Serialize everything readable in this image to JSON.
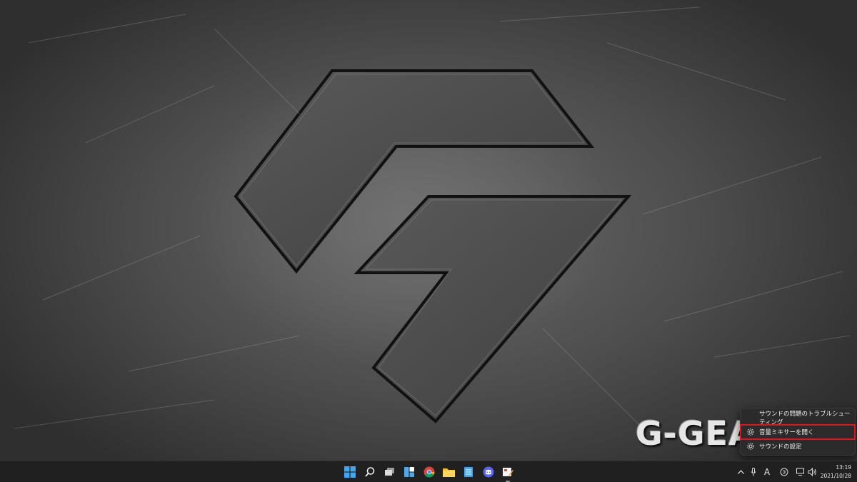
{
  "desktop": {
    "wallpaper": "G-GEAR scratched metal logo wallpaper",
    "wordmark": "G-GEA"
  },
  "context_menu": {
    "items": [
      {
        "label": "サウンドの問題のトラブルシューティング",
        "icon": null,
        "highlighted": false
      },
      {
        "label": "音量ミキサーを開く",
        "icon": "gear-icon",
        "highlighted": true
      },
      {
        "label": "サウンドの設定",
        "icon": "gear-icon",
        "highlighted": false
      }
    ],
    "highlight_color": "#e0141e"
  },
  "taskbar": {
    "apps": [
      {
        "name": "start-button",
        "icon": "windows-logo-icon"
      },
      {
        "name": "search-button",
        "icon": "search-icon"
      },
      {
        "name": "task-view-button",
        "icon": "task-view-icon"
      },
      {
        "name": "widgets-button",
        "icon": "widgets-icon"
      },
      {
        "name": "chrome-button",
        "icon": "chrome-icon"
      },
      {
        "name": "file-explorer-button",
        "icon": "folder-icon"
      },
      {
        "name": "notepad-button",
        "icon": "notepad-icon"
      },
      {
        "name": "discord-button",
        "icon": "discord-icon"
      },
      {
        "name": "paint-button",
        "icon": "paint-icon"
      }
    ],
    "tray": {
      "chevron": "^",
      "ime": "A"
    },
    "clock": {
      "time": "13:19",
      "date": "2021/10/28"
    }
  }
}
